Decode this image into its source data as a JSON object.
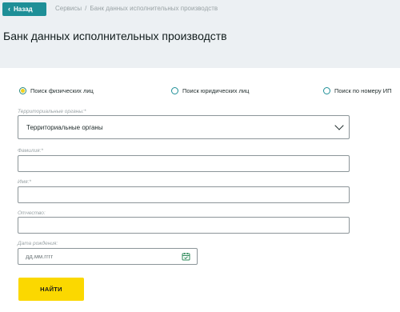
{
  "header": {
    "back_label": "Назад",
    "breadcrumb": [
      "Сервисы",
      "/",
      "Банк данных исполнительных производств"
    ],
    "title": "Банк данных исполнительных производств"
  },
  "search_type": {
    "options": [
      "Поиск физических лиц",
      "Поиск юридических лиц",
      "Поиск по номеру ИП"
    ],
    "selected": "Поиск физических лиц"
  },
  "form": {
    "territorial": {
      "label": "Территориальные органы:*",
      "value": "Территориальные органы"
    },
    "surname": {
      "label": "Фамилия:*",
      "value": ""
    },
    "name": {
      "label": "Имя:*",
      "value": ""
    },
    "patronymic": {
      "label": "Отчество:",
      "value": ""
    },
    "birthdate": {
      "label": "Дата рождения:",
      "placeholder": "дд.мм.гггг"
    },
    "submit_label": "НАЙТИ"
  },
  "colors": {
    "accent": "#1e8f97",
    "button": "#fbd800",
    "radio_selected": "#f1d21d"
  }
}
